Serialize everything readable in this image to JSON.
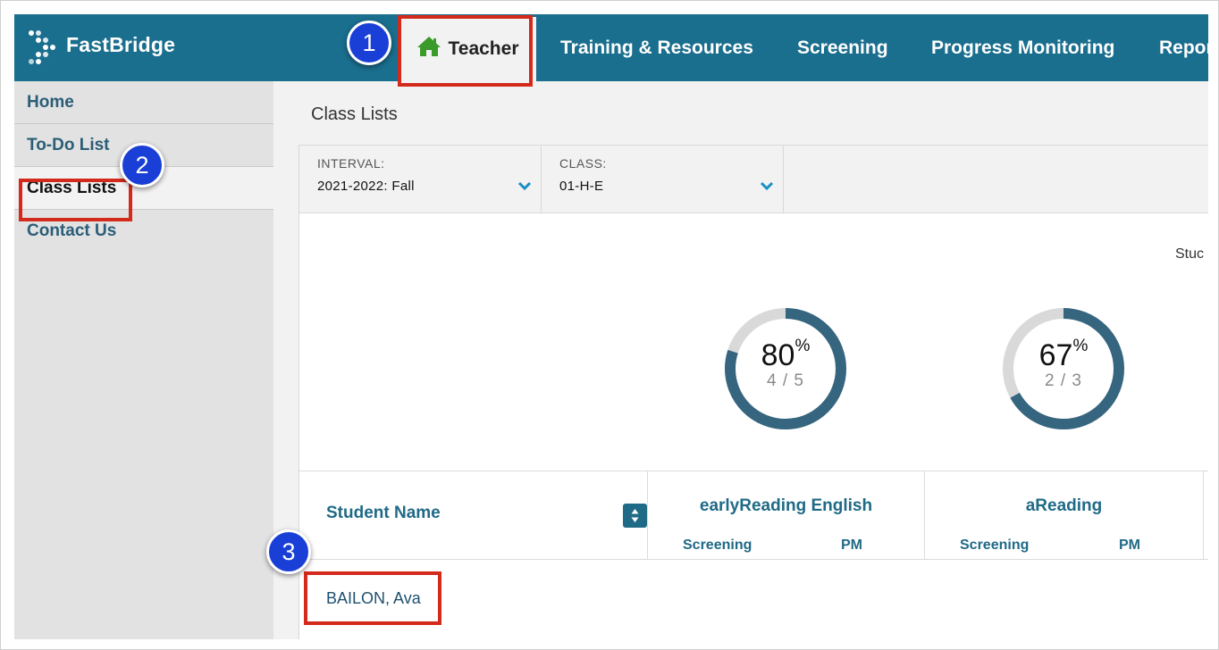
{
  "app": {
    "logo_text": "FastBridge",
    "brand_color": "#1a6e8e",
    "annotation_color": "#d42a1c",
    "badge_color": "#1a3fd6"
  },
  "topnav": {
    "items": [
      {
        "label": "Teacher",
        "icon": "home-icon",
        "active": true
      },
      {
        "label": "Training & Resources"
      },
      {
        "label": "Screening"
      },
      {
        "label": "Progress Monitoring"
      },
      {
        "label": "Repor"
      }
    ]
  },
  "sidebar": {
    "items": [
      {
        "label": "Home"
      },
      {
        "label": "To-Do List"
      },
      {
        "label": "Class Lists",
        "active": true
      },
      {
        "label": "Contact Us"
      }
    ]
  },
  "main": {
    "title": "Class Lists",
    "filters": [
      {
        "label": "INTERVAL:",
        "value": "2021-2022: Fall",
        "icon": "chevron-down-icon"
      },
      {
        "label": "CLASS:",
        "value": "01-H-E",
        "icon": "chevron-down-icon"
      }
    ],
    "stud_label": "Stuc",
    "donuts": [
      {
        "percent": "80",
        "unit": "%",
        "fraction": "4 / 5",
        "value": 0.8
      },
      {
        "percent": "67",
        "unit": "%",
        "fraction": "2 / 3",
        "value": 0.67
      }
    ],
    "table": {
      "name_header": "Student Name",
      "groups": [
        {
          "title": "earlyReading English",
          "sub": [
            "Screening",
            "PM"
          ]
        },
        {
          "title": "aReading",
          "sub": [
            "Screening",
            "PM"
          ]
        }
      ],
      "rows": [
        {
          "name": "BAILON, Ava"
        }
      ]
    }
  },
  "annotations": {
    "badges": [
      "1",
      "2",
      "3"
    ]
  }
}
